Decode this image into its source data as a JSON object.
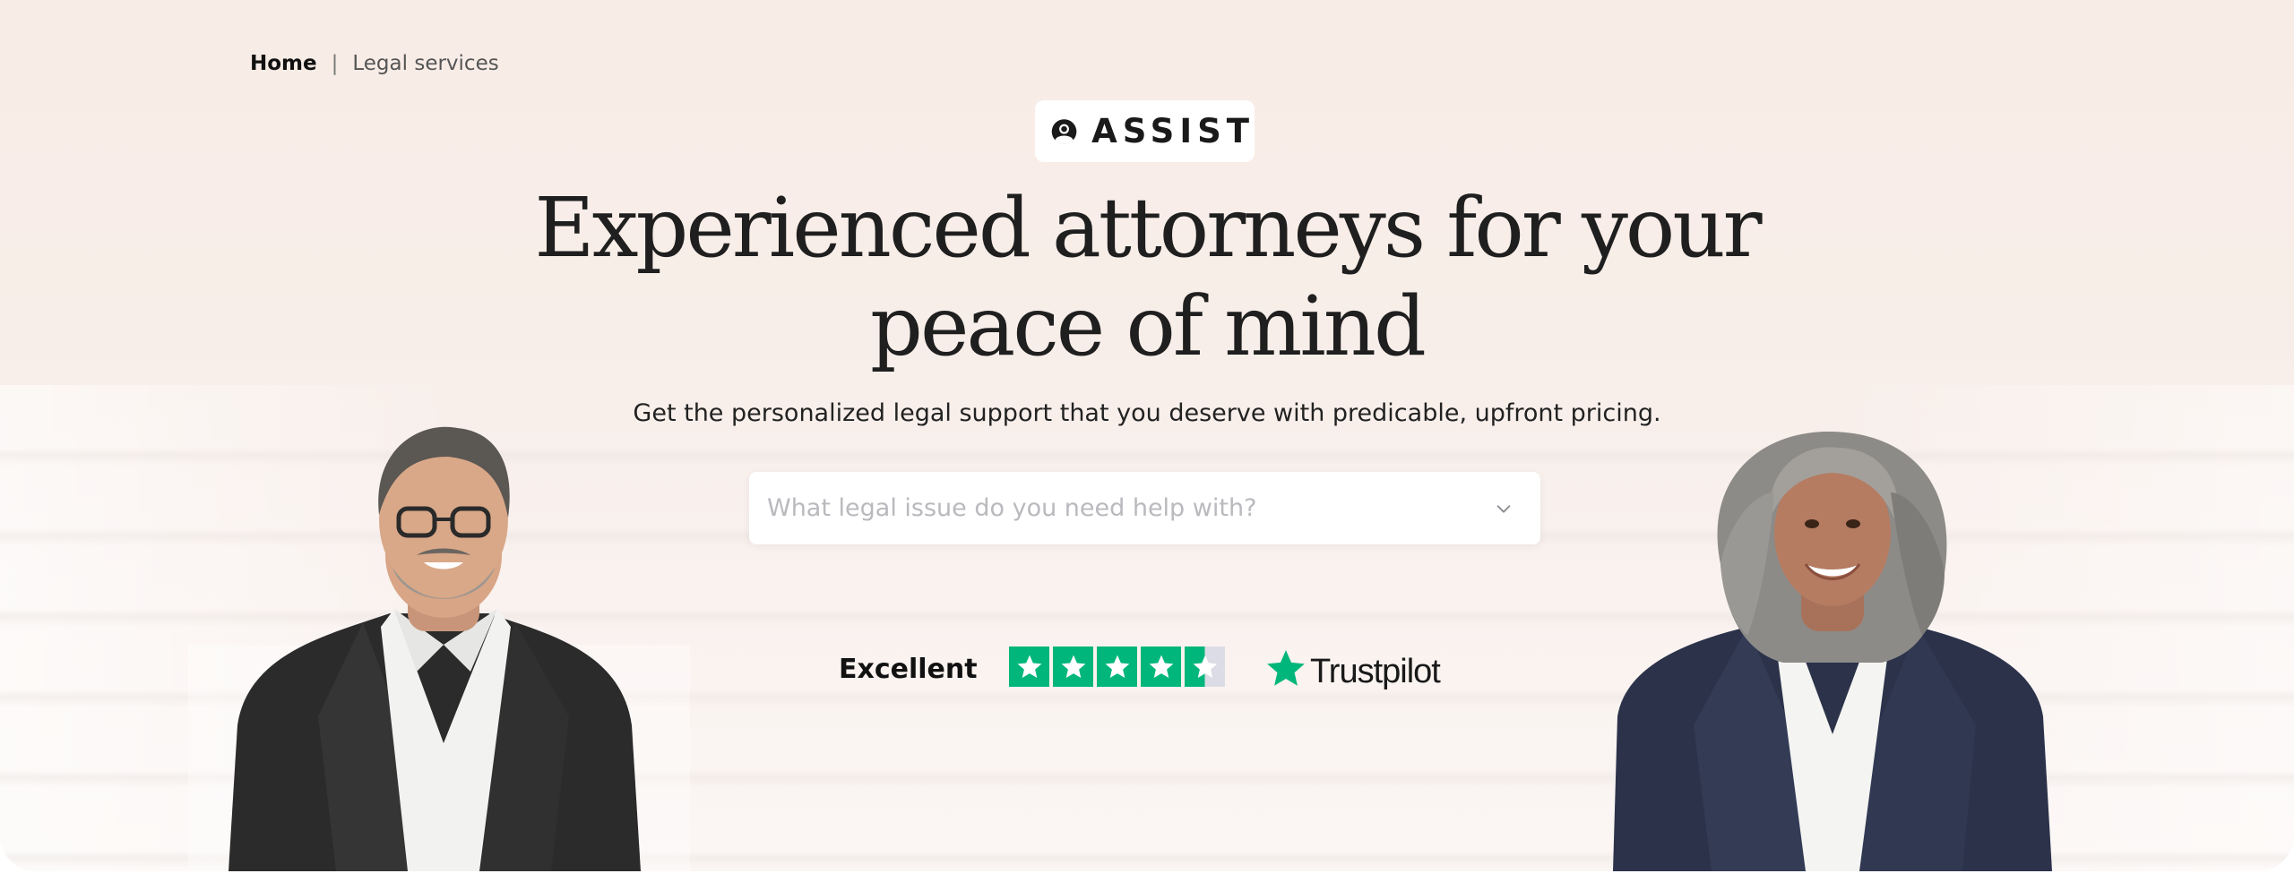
{
  "breadcrumb": {
    "home": "Home",
    "separator": "|",
    "current": "Legal services"
  },
  "logo": {
    "text": "ASSIST",
    "icon": "person-circle-icon"
  },
  "hero": {
    "headline_line1": "Experienced attorneys for your",
    "headline_line2": "peace of mind",
    "subtitle": "Get the personalized legal support that you deserve with predicable, upfront pricing."
  },
  "search": {
    "placeholder": "What legal issue do you need help with?",
    "icon": "chevron-down-icon"
  },
  "rating": {
    "label": "Excellent",
    "stars": 4.5,
    "max_stars": 5,
    "provider": "Trustpilot"
  },
  "colors": {
    "background": "#f8ece6",
    "trustpilot_green": "#00b67a",
    "text_dark": "#1f1f1f",
    "placeholder": "#b9b9be"
  }
}
